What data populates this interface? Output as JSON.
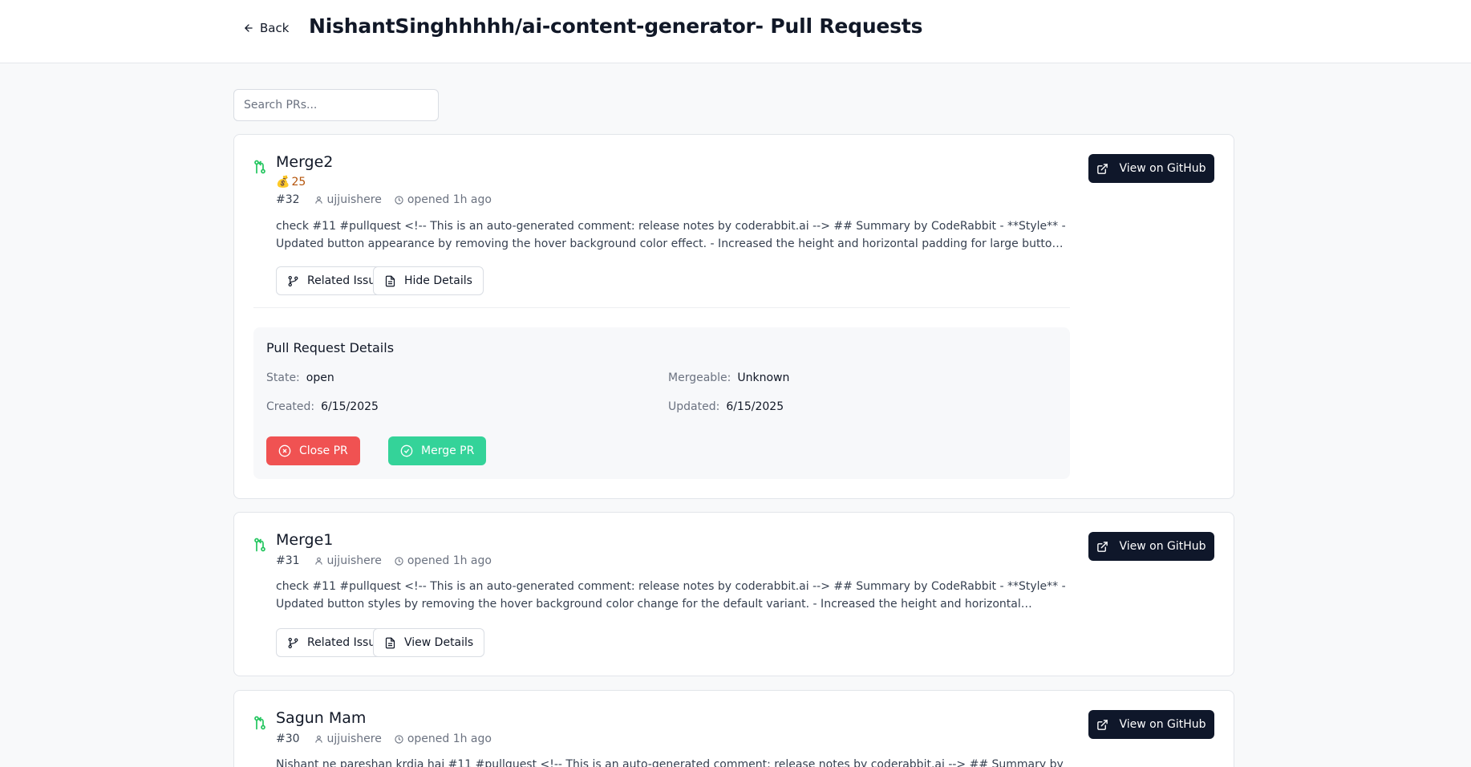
{
  "header": {
    "back_label": "Back",
    "title": "NishantSinghhhhh/ai-content-generator- Pull Requests"
  },
  "search": {
    "placeholder": "Search PRs..."
  },
  "colors": {
    "accent_dark": "#0f172a",
    "close": "#f05252",
    "merge": "#34d399",
    "pr_icon": "#22c55e"
  },
  "icons": [
    "arrow-left-icon",
    "pull-request-icon",
    "user-icon",
    "clock-icon",
    "git-branch-icon",
    "file-text-icon",
    "external-link-icon",
    "x-circle-icon",
    "check-circle-icon",
    "money-bag-icon"
  ],
  "pull_requests": [
    {
      "title": "Merge2",
      "bounty": "25",
      "number": "#32",
      "author": "ujjuishere",
      "opened": "opened 1h ago",
      "description": "check #11 #pullquest <!-- This is an auto-generated comment: release notes by coderabbit.ai --> ## Summary by CodeRabbit - **Style** - Updated button appearance by removing the hover background color effect. - Increased the height and horizontal padding for large buttons. - **Documentation** - Added a new line to the README.",
      "related_label": "Related Issue",
      "details_toggle_label": "Hide Details",
      "github_label": "View on GitHub",
      "details": {
        "heading": "Pull Request Details",
        "state_label": "State:",
        "state": "open",
        "mergeable_label": "Mergeable:",
        "mergeable": "Unknown",
        "created_label": "Created:",
        "created": "6/15/2025",
        "updated_label": "Updated:",
        "updated": "6/15/2025",
        "close_label": "Close PR",
        "merge_label": "Merge PR"
      }
    },
    {
      "title": "Merge1",
      "number": "#31",
      "author": "ujjuishere",
      "opened": "opened 1h ago",
      "description": "check #11 #pullquest <!-- This is an auto-generated comment: release notes by coderabbit.ai --> ## Summary by CodeRabbit - **Style** - Updated button styles by removing the hover background color change for the default variant. - Increased the height and horizontal padding for large buttons to enhance visibility.",
      "related_label": "Related Issue",
      "details_toggle_label": "View Details",
      "github_label": "View on GitHub"
    },
    {
      "title": "Sagun Mam",
      "number": "#30",
      "author": "ujjuishere",
      "opened": "opened 1h ago",
      "description": "Nishant ne pareshan krdia hai #11 #pullquest <!-- This is an auto-generated comment: release notes by coderabbit.ai --> ## Summary by CodeRabbit -",
      "github_label": "View on GitHub"
    }
  ]
}
